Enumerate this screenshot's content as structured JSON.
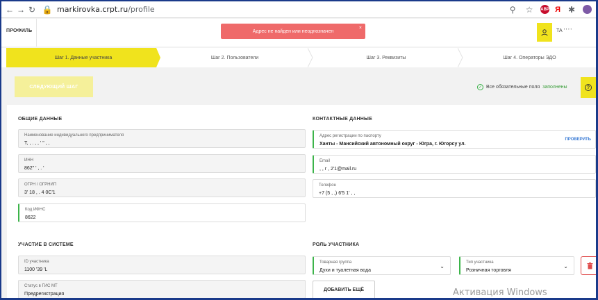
{
  "browser": {
    "url_host": "markirovka.crpt.ru",
    "url_path": "/profile",
    "ext_abp": "ABP",
    "ext_ya": "Я"
  },
  "header": {
    "page_title": "ПРОФИЛЬ",
    "alert_text": "Адрес не найден или неоднозначен",
    "alert_close": "×",
    "user_name": "ТА  '   '  '  '"
  },
  "steps": [
    {
      "label": "Шаг 1. Данные участника",
      "active": true
    },
    {
      "label": "Шаг 2. Пользователи",
      "active": false
    },
    {
      "label": "Шаг 3. Реквизиты",
      "active": false
    },
    {
      "label": "Шаг 4. Операторы ЭДО",
      "active": false
    }
  ],
  "toolbar": {
    "next_button": "СЛЕДУЮЩИЙ ШАГ",
    "required_text": "Все обязательные поля",
    "required_link": "заполнены",
    "help": "?"
  },
  "general": {
    "title": "ОБЩИЕ ДАННЫЕ",
    "fields": [
      {
        "label": "Наименование индивидуального предпринимателя",
        "value": "Т,  ,  .  ,    ,  '  \"  ,  ,"
      },
      {
        "label": "ИНН",
        "value": "862\" '  ,  .  '"
      },
      {
        "label": "ОГРН / ОГРНИП",
        "value": "3' 18 , .  4   0С'1"
      },
      {
        "label": "Код ИФНС",
        "value": "8622"
      }
    ]
  },
  "contacts": {
    "title": "КОНТАКТНЫЕ ДАННЫЕ",
    "fields": [
      {
        "label": "Адрес регистрации по паспорту",
        "value": "Ханты - Мансийский автономный округ - Югра, г. Югорсу ул.",
        "action": "ПРОВЕРИТЬ"
      },
      {
        "label": "Email",
        "value": "  ,  ,  r  ,  2'1@mail.ru"
      },
      {
        "label": "Телефон",
        "value": "+7 (5 , ,) 6'5  1' , ,"
      }
    ]
  },
  "system": {
    "title": "УЧАСТИЕ В СИСТЕМЕ",
    "fields": [
      {
        "label": "ID участника",
        "value": "1100 '39  'L"
      },
      {
        "label": "Статус в ГИС МТ",
        "value": "Предрегистрация"
      }
    ]
  },
  "role": {
    "title": "РОЛЬ УЧАСТНИКА",
    "product_group_label": "Товарная группа",
    "product_group_value": "Духи и туалетная вода",
    "participant_type_label": "Тип участника",
    "participant_type_value": "Розничная торговля",
    "add_more": "ДОБАВИТЬ ЕЩЁ"
  },
  "watermark": "Активация Windows",
  "colors": {
    "accent_yellow": "#f0e31d",
    "alert_red": "#ef6a6a",
    "ok_green": "#3cb44a",
    "link_blue": "#3a7bd5"
  }
}
